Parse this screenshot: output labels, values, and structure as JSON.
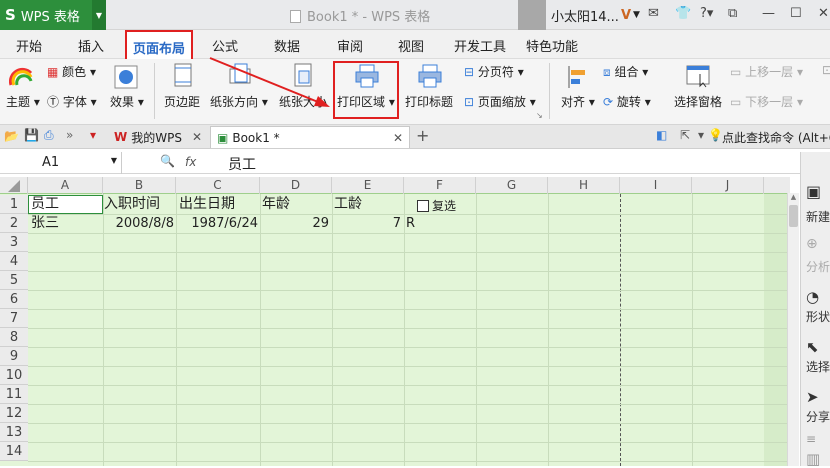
{
  "titlebar": {
    "app_name": "WPS 表格",
    "app_logo": "S",
    "doc_title": "Book1 * - WPS 表格",
    "user_name": "小太阳14...",
    "user_badge": "V",
    "icons": [
      "mail-icon",
      "shirt-icon",
      "help-icon",
      "restore-icon",
      "minimize-icon",
      "maximize-icon"
    ]
  },
  "menu": {
    "tabs": [
      "开始",
      "插入",
      "页面布局",
      "公式",
      "数据",
      "审阅",
      "视图",
      "开发工具",
      "特色功能"
    ],
    "active_tab": "页面布局"
  },
  "ribbon": {
    "color": "颜色",
    "theme": "主题",
    "font": "字体",
    "effect": "效果",
    "margins": "页边距",
    "orientation": "纸张方向",
    "paper_size": "纸张大小",
    "print_area": "打印区域",
    "print_titles": "打印标题",
    "page_break": "分页符",
    "page_zoom": "页面缩放",
    "align": "对齐",
    "group": "组合",
    "rotate": "旋转",
    "selection_pane": "选择窗格",
    "bring_forward": "上移一层",
    "send_backward": "下移一层"
  },
  "tabsbar": {
    "tab1": "我的WPS",
    "tab2": "Book1 *",
    "search_hint": "点此查找命令 (Alt+Q)"
  },
  "formula": {
    "cell_ref": "A1",
    "fx": "fx",
    "content": "员工"
  },
  "sheet": {
    "columns": [
      "A",
      "B",
      "C",
      "D",
      "E",
      "F",
      "G",
      "H",
      "I",
      "J"
    ],
    "rows": [
      "1",
      "2",
      "3",
      "4",
      "5",
      "6",
      "7",
      "8",
      "9",
      "10",
      "11",
      "12",
      "13",
      "14"
    ],
    "r1": {
      "a": "员工",
      "b": "入职时间",
      "c": "出生日期",
      "d": "年龄",
      "e": "工龄",
      "f": "复选"
    },
    "r2": {
      "a": "张三",
      "b": "2008/8/8",
      "c": "1987/6/24",
      "d": "29",
      "e": "7",
      "f": "R"
    }
  },
  "rightpanel": {
    "new": "新建",
    "analyze": "分析",
    "shape": "形状",
    "select": "选择",
    "share": "分享"
  }
}
